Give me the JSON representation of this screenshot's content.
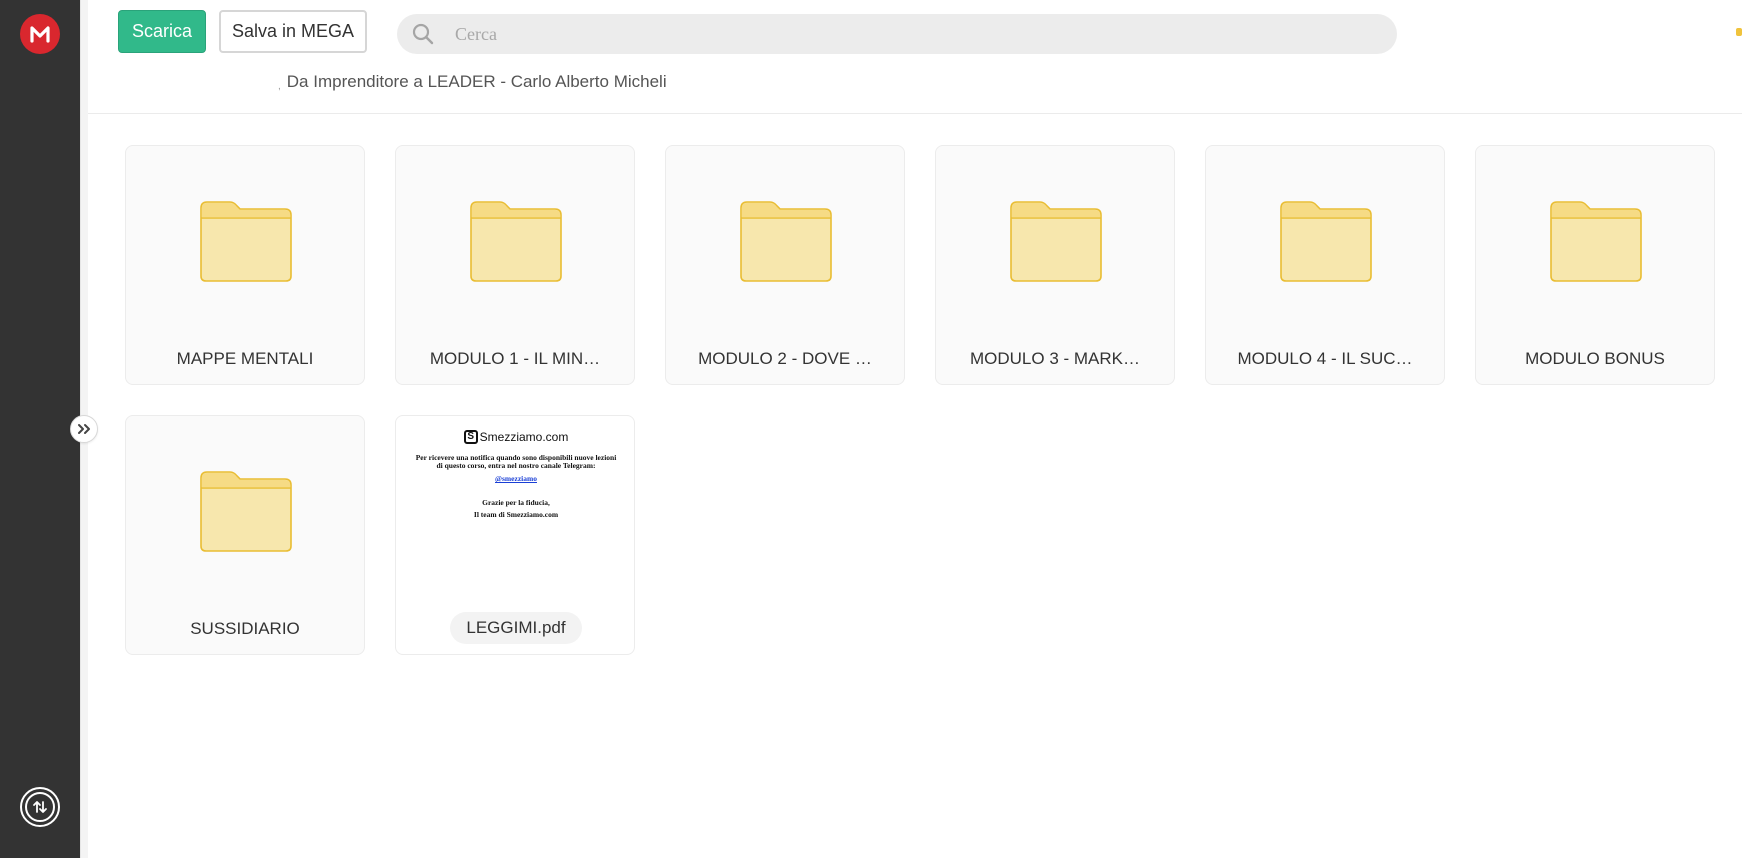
{
  "toolbar": {
    "download_label": "Scarica",
    "save_label": "Salva in MEGA"
  },
  "search": {
    "placeholder": "Cerca"
  },
  "breadcrumb": {
    "separator": ",",
    "current": "Da Imprenditore a LEADER - Carlo Alberto Micheli"
  },
  "colors": {
    "sidebar": "#333333",
    "brand": "#d9272e",
    "accent": "#31b98a",
    "folder": "#f7e7ad"
  },
  "items": [
    {
      "type": "folder",
      "name": "MAPPE MENTALI"
    },
    {
      "type": "folder",
      "name": "MODULO 1 - IL MIN…"
    },
    {
      "type": "folder",
      "name": "MODULO 2 - DOVE …"
    },
    {
      "type": "folder",
      "name": "MODULO 3 - MARK…"
    },
    {
      "type": "folder",
      "name": "MODULO 4 - IL SUC…"
    },
    {
      "type": "folder",
      "name": "MODULO BONUS"
    },
    {
      "type": "folder",
      "name": "SUSSIDIARIO"
    },
    {
      "type": "pdf",
      "name": "LEGGIMI.pdf"
    }
  ],
  "pdf_preview": {
    "brand": "Smezziamo.com",
    "line1": "Per ricevere una notifica quando sono disponibili nuove lezioni",
    "line2": "di questo corso, entra nel nostro canale Telegram:",
    "link": "@smezziamo",
    "thanks1": "Grazie per la fiducia,",
    "thanks2": "Il team di Smezziamo.com"
  }
}
